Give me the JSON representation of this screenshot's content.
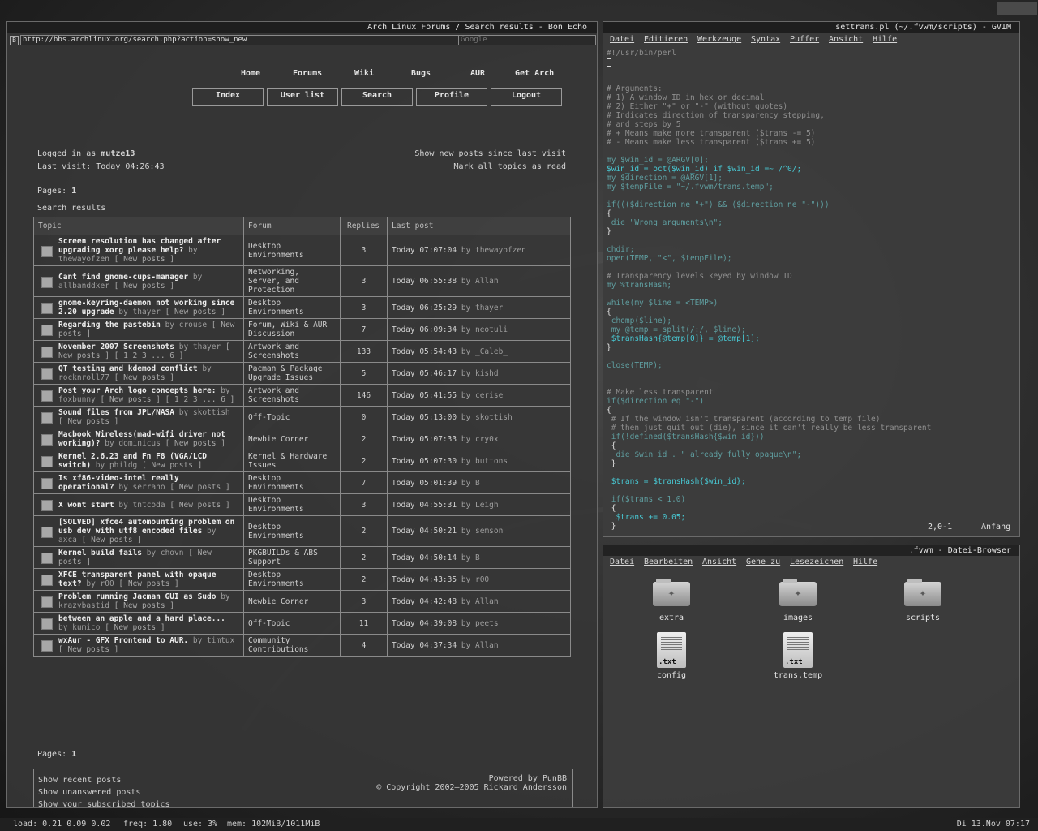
{
  "browser": {
    "title": "Arch Linux Forums / Search results - Bon Echo",
    "url": "http://bbs.archlinux.org/search.php?action=show_new",
    "search_placeholder": "Google",
    "nav_top": [
      "Home",
      "Forums",
      "Wiki",
      "Bugs",
      "AUR",
      "Get Arch"
    ],
    "nav_buttons": [
      "Index",
      "User list",
      "Search",
      "Profile",
      "Logout"
    ],
    "logged_in_label": "Logged in as",
    "username": "mutze13",
    "last_visit": "Last visit: Today 04:26:43",
    "show_new_posts": "Show new posts since last visit",
    "mark_all_read": "Mark all topics as read",
    "pages_label": "Pages:",
    "page_number": "1",
    "search_results": "Search results",
    "headers": [
      "Topic",
      "Forum",
      "Replies",
      "Last post"
    ],
    "rows": [
      {
        "title": "Screen resolution has changed after upgrading xorg please help?",
        "by": "by thewayofzen",
        "extra": "[ New posts ]",
        "forum": "Desktop Environments",
        "replies": "3",
        "last": "Today 07:07:04",
        "last_by": "by thewayofzen"
      },
      {
        "title": "Cant find gnome-cups-manager",
        "by": "by allbanddxer",
        "extra": "[ New posts ]",
        "forum": "Networking, Server, and Protection",
        "replies": "3",
        "last": "Today 06:55:38",
        "last_by": "by Allan"
      },
      {
        "title": "gnome-keyring-daemon not working since 2.20 upgrade",
        "by": "by thayer",
        "extra": "[ New posts ]",
        "forum": "Desktop Environments",
        "replies": "3",
        "last": "Today 06:25:29",
        "last_by": "by thayer"
      },
      {
        "title": "Regarding the pastebin",
        "by": "by crouse",
        "extra": "[ New posts ]",
        "forum": "Forum, Wiki & AUR Discussion",
        "replies": "7",
        "last": "Today 06:09:34",
        "last_by": "by neotuli"
      },
      {
        "title": "November 2007 Screenshots",
        "by": "by thayer",
        "extra": "[ New posts ] [ 1 2 3 ... 6 ]",
        "forum": "Artwork and Screenshots",
        "replies": "133",
        "last": "Today 05:54:43",
        "last_by": "by _Caleb_"
      },
      {
        "title": "QT testing and kdemod conflict",
        "by": "by rocknroll77",
        "extra": "[ New posts ]",
        "forum": "Pacman & Package Upgrade Issues",
        "replies": "5",
        "last": "Today 05:46:17",
        "last_by": "by kishd"
      },
      {
        "title": "Post your Arch logo concepts here:",
        "by": "by foxbunny",
        "extra": "[ New posts ] [ 1 2 3 ... 6 ]",
        "forum": "Artwork and Screenshots",
        "replies": "146",
        "last": "Today 05:41:55",
        "last_by": "by cerise"
      },
      {
        "title": "Sound files from JPL/NASA",
        "by": "by skottish",
        "extra": "[ New posts ]",
        "forum": "Off-Topic",
        "replies": "0",
        "last": "Today 05:13:00",
        "last_by": "by skottish"
      },
      {
        "title": "Macbook Wireless(mad-wifi driver not working)?",
        "by": "by dominicus",
        "extra": "[ New posts ]",
        "forum": "Newbie Corner",
        "replies": "2",
        "last": "Today 05:07:33",
        "last_by": "by cry0x"
      },
      {
        "title": "Kernel 2.6.23 and Fn F8 (VGA/LCD switch)",
        "by": "by phildg",
        "extra": "[ New posts ]",
        "forum": "Kernel & Hardware Issues",
        "replies": "2",
        "last": "Today 05:07:30",
        "last_by": "by buttons"
      },
      {
        "title": "Is xf86-video-intel really operational?",
        "by": "by serrano",
        "extra": "[ New posts ]",
        "forum": "Desktop Environments",
        "replies": "7",
        "last": "Today 05:01:39",
        "last_by": "by B"
      },
      {
        "title": "X wont start",
        "by": "by tntcoda",
        "extra": "[ New posts ]",
        "forum": "Desktop Environments",
        "replies": "3",
        "last": "Today 04:55:31",
        "last_by": "by Leigh"
      },
      {
        "title": "[SOLVED] xfce4 automounting problem on usb dev with utf8 encoded files",
        "by": "by axca",
        "extra": "[ New posts ]",
        "forum": "Desktop Environments",
        "replies": "2",
        "last": "Today 04:50:21",
        "last_by": "by semson"
      },
      {
        "title": "Kernel build fails",
        "by": "by chovn",
        "extra": "[ New posts ]",
        "forum": "PKGBUILDs & ABS Support",
        "replies": "2",
        "last": "Today 04:50:14",
        "last_by": "by B"
      },
      {
        "title": "XFCE transparent panel with opaque text?",
        "by": "by r00",
        "extra": "[ New posts ]",
        "forum": "Desktop Environments",
        "replies": "2",
        "last": "Today 04:43:35",
        "last_by": "by r00"
      },
      {
        "title": "Problem running Jacman GUI as Sudo",
        "by": "by krazybastid",
        "extra": "[ New posts ]",
        "forum": "Newbie Corner",
        "replies": "3",
        "last": "Today 04:42:48",
        "last_by": "by Allan"
      },
      {
        "title": "between an apple and a hard place...",
        "by": "by kumico",
        "extra": "[ New posts ]",
        "forum": "Off-Topic",
        "replies": "11",
        "last": "Today 04:39:08",
        "last_by": "by peets"
      },
      {
        "title": "wxAur - GFX Frontend to AUR.",
        "by": "by timtux",
        "extra": "[ New posts ]",
        "forum": "Community Contributions",
        "replies": "4",
        "last": "Today 04:37:34",
        "last_by": "by Allan"
      }
    ],
    "footer_links": [
      "Show recent posts",
      "Show unanswered posts",
      "Show your subscribed topics"
    ],
    "powered_by": "Powered by",
    "punbb": "PunBB",
    "copyright": "© Copyright 2002–2005 Rickard Andersson"
  },
  "gvim": {
    "title": "settrans.pl (~/.fvwm/scripts) - GVIM",
    "menu": [
      "Datei",
      "Editieren",
      "Werkzeuge",
      "Syntax",
      "Puffer",
      "Ansicht",
      "Hilfe"
    ],
    "status_pos": "2,0-1",
    "status_loc": "Anfang"
  },
  "filebrowser": {
    "title": ".fvwm - Datei-Browser",
    "menu": [
      "Datei",
      "Bearbeiten",
      "Ansicht",
      "Gehe zu",
      "Lesezeichen",
      "Hilfe"
    ],
    "folders": [
      "extra",
      "images",
      "scripts"
    ],
    "files": [
      "config",
      "trans.temp"
    ],
    "file_ext": ".txt"
  },
  "taskbar": {
    "load": "load: 0.21 0.09 0.02",
    "freq": "freq: 1.80",
    "use": "use: 3%",
    "mem": "mem: 102MiB/1011MiB",
    "datetime": "Di 13.Nov 07:17"
  },
  "code_lines": [
    "#!/usr/bin/perl",
    "",
    "",
    "# Arguments:",
    "# 1) A window ID in hex or decimal",
    "# 2) Either \"+\" or \"-\" (without quotes)",
    "# Indicates direction of transparency stepping,",
    "# and steps by 5",
    "# + Means make more transparent ($trans -= 5)",
    "# - Means make less transparent ($trans += 5)",
    "",
    "my $win_id = @ARGV[0];",
    "$win_id = oct($win_id) if $win_id =~ /^0/;",
    "my $direction = @ARGV[1];",
    "my $tempFile = \"~/.fvwm/trans.temp\";",
    "",
    "if((($direction ne \"+\") && ($direction ne \"-\")))",
    "{",
    " die \"Wrong arguments\\n\";",
    "}",
    "",
    "chdir;",
    "open(TEMP, \"<\", $tempFile);",
    "",
    "# Transparency levels keyed by window ID",
    "my %transHash;",
    "",
    "while(my $line = <TEMP>)",
    "{",
    " chomp($line);",
    " my @temp = split(/:/, $line);",
    " $transHash{@temp[0]} = @temp[1];",
    "}",
    "",
    "close(TEMP);",
    "",
    "",
    "# Make less transparent",
    "if($direction eq \"-\")",
    "{",
    " # If the window isn't transparent (according to temp file)",
    " # then just quit out (die), since it can't really be less transparent",
    " if(!defined($transHash{$win_id}))",
    " {",
    "  die $win_id . \" already fully opaque\\n\";",
    " }",
    "",
    " $trans = $transHash{$win_id};",
    "",
    " if($trans < 1.0)",
    " {",
    "  $trans += 0.05;",
    " }"
  ]
}
